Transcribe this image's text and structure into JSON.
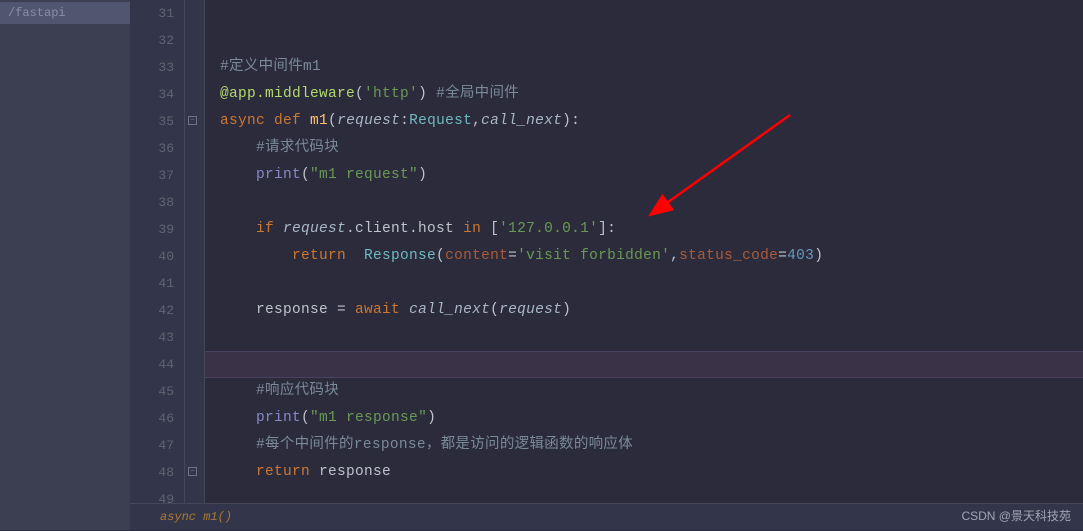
{
  "sidebar": {
    "item": "/fastapi"
  },
  "gutter": {
    "start": 31,
    "end": 49
  },
  "code": {
    "l31": "",
    "l32": "",
    "l33_comment": "#定义中间件m1",
    "l34_dec": "@app.middleware",
    "l34_arg": "'http'",
    "l34_comment": " #全局中间件",
    "l35_async": "async ",
    "l35_def": "def ",
    "l35_name": "m1",
    "l35_p1": "request",
    "l35_t1": "Request",
    "l35_p2": "call_next",
    "l36_comment": "#请求代码块",
    "l37_print": "print",
    "l37_str": "\"m1 request\"",
    "l38": "",
    "l39_if": "if ",
    "l39_req": "request",
    "l39_client": ".client.host ",
    "l39_in": "in ",
    "l39_list": "['127.0.0.1']",
    "l40_return": "return  ",
    "l40_resp": "Response",
    "l40_kw1": "content",
    "l40_v1": "'visit forbidden'",
    "l40_kw2": "status_code",
    "l40_v2": "403",
    "l41": "",
    "l42_var": "response ",
    "l42_eq": "= ",
    "l42_await": "await ",
    "l42_call": "call_next",
    "l42_arg": "request",
    "l43": "",
    "l44": "",
    "l45_comment": "#响应代码块",
    "l46_print": "print",
    "l46_str": "\"m1 response\"",
    "l47_comment": "#每个中间件的response，都是访问的逻辑函数的响应体",
    "l48_return": "return ",
    "l48_var": "response",
    "l49": ""
  },
  "breadcrumb": {
    "text": "async m1()"
  },
  "watermark": {
    "text": "CSDN @景天科技苑"
  }
}
